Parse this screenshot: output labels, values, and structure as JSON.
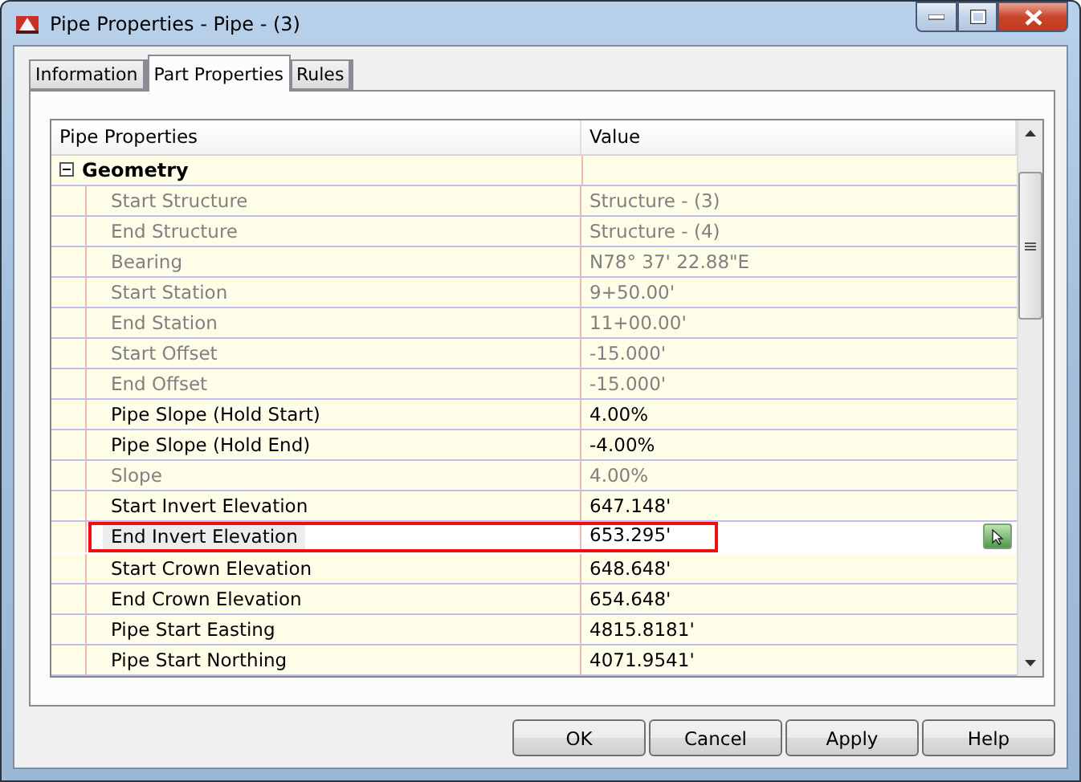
{
  "window": {
    "title": "Pipe Properties - Pipe - (3)"
  },
  "tabs": [
    {
      "label": "Information",
      "selected": false
    },
    {
      "label": "Part Properties",
      "selected": true
    },
    {
      "label": "Rules",
      "selected": false
    }
  ],
  "table": {
    "columns": [
      "Pipe Properties",
      "Value"
    ],
    "groups": [
      {
        "label": "Geometry",
        "expanded": true,
        "rows": [
          {
            "name": "Start Structure",
            "value": "Structure - (3)",
            "disabled": true,
            "selected": false,
            "highlighted": false
          },
          {
            "name": "End Structure",
            "value": "Structure - (4)",
            "disabled": true,
            "selected": false,
            "highlighted": false
          },
          {
            "name": "Bearing",
            "value": "N78° 37' 22.88\"E",
            "disabled": true,
            "selected": false,
            "highlighted": false
          },
          {
            "name": "Start Station",
            "value": "9+50.00'",
            "disabled": true,
            "selected": false,
            "highlighted": false
          },
          {
            "name": "End Station",
            "value": "11+00.00'",
            "disabled": true,
            "selected": false,
            "highlighted": false
          },
          {
            "name": "Start Offset",
            "value": "-15.000'",
            "disabled": true,
            "selected": false,
            "highlighted": false
          },
          {
            "name": "End Offset",
            "value": "-15.000'",
            "disabled": true,
            "selected": false,
            "highlighted": false
          },
          {
            "name": "Pipe Slope (Hold Start)",
            "value": "4.00%",
            "disabled": false,
            "selected": false,
            "highlighted": false
          },
          {
            "name": "Pipe Slope (Hold End)",
            "value": "-4.00%",
            "disabled": false,
            "selected": false,
            "highlighted": false
          },
          {
            "name": "Slope",
            "value": "4.00%",
            "disabled": true,
            "selected": false,
            "highlighted": false
          },
          {
            "name": "Start Invert Elevation",
            "value": "647.148'",
            "disabled": false,
            "selected": false,
            "highlighted": false
          },
          {
            "name": "End Invert Elevation",
            "value": "653.295'",
            "disabled": false,
            "selected": true,
            "highlighted": true
          },
          {
            "name": "Start Crown Elevation",
            "value": "648.648'",
            "disabled": false,
            "selected": false,
            "highlighted": false
          },
          {
            "name": "End Crown Elevation",
            "value": "654.648'",
            "disabled": false,
            "selected": false,
            "highlighted": false
          },
          {
            "name": "Pipe Start Easting",
            "value": "4815.8181'",
            "disabled": false,
            "selected": false,
            "highlighted": false
          },
          {
            "name": "Pipe Start Northing",
            "value": "4071.9541'",
            "disabled": false,
            "selected": false,
            "highlighted": false
          }
        ]
      }
    ]
  },
  "buttons": [
    "OK",
    "Cancel",
    "Apply",
    "Help"
  ]
}
